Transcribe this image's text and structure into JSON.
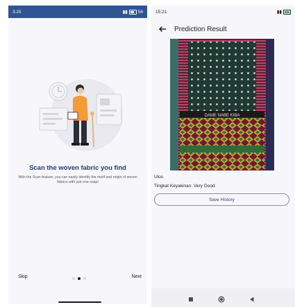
{
  "onboarding": {
    "status_time": "3:25",
    "status_battery": "56",
    "title": "Scan the woven fabric you find",
    "description": "With the Scan feature, you can easily identify the motif and origin of woven fabrics with just one snap!",
    "skip_label": "Skip",
    "next_label": "Next",
    "page_index": 2,
    "page_count": 3
  },
  "result": {
    "status_time": "15:21",
    "title": "Prediction Result",
    "class_name": "Ulos",
    "confidence": "Tingkat Keyakinan: Very Good",
    "save_label": "Save History",
    "fabric_text": "DAME NABE KIBA"
  },
  "icons": {
    "back": "arrow-left-icon",
    "nav_recents": "square-icon",
    "nav_home": "circle-icon",
    "nav_back": "triangle-icon"
  },
  "colors": {
    "onboarding_statusbar": "#2f5593",
    "title_blue": "#1f3b6e",
    "accent_orange": "#f29b38",
    "fabric_maroon": "#8a3350",
    "fabric_green": "#1f3a33"
  }
}
